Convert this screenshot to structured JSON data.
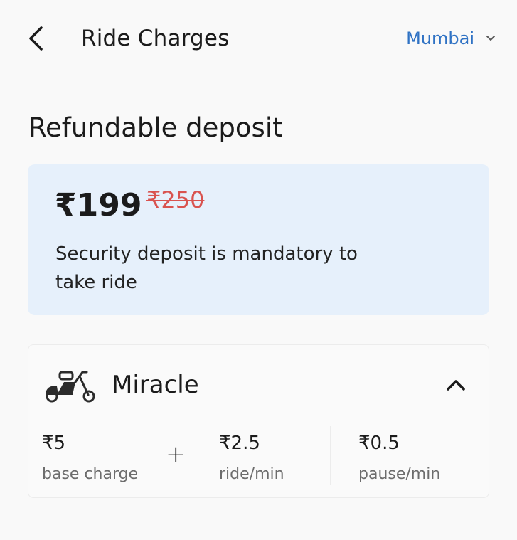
{
  "header": {
    "title": "Ride Charges",
    "city": "Mumbai",
    "back_icon": "back-arrow-icon",
    "dropdown_icon": "chevron-down-icon"
  },
  "deposit": {
    "heading": "Refundable deposit",
    "price": "₹199",
    "original_price": "₹250",
    "note": "Security deposit is mandatory to take ride"
  },
  "vehicle": {
    "icon": "scooter-icon",
    "name": "Miracle",
    "expand_icon": "chevron-up-icon",
    "plus": "+",
    "fees": [
      {
        "value": "₹5",
        "label": "base charge"
      },
      {
        "value": "₹2.5",
        "label": "ride/min"
      },
      {
        "value": "₹0.5",
        "label": "pause/min"
      }
    ]
  },
  "colors": {
    "accent": "#2f72c4",
    "strike": "#d9534f",
    "card_bg": "#e6f0fb",
    "page_bg": "#f9f9f9"
  }
}
